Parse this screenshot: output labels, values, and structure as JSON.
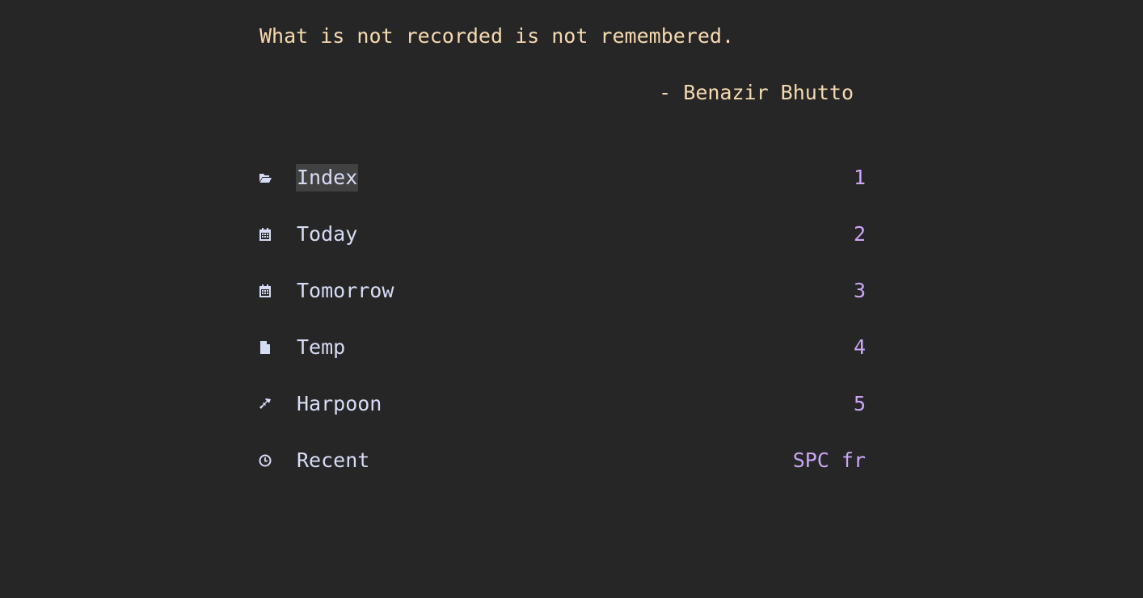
{
  "header": {
    "quote": "What is not recorded is not remembered.",
    "author": "- Benazir Bhutto"
  },
  "menu": {
    "items": [
      {
        "icon": "folder-open-icon",
        "label": "Index",
        "key": "1",
        "selected": true
      },
      {
        "icon": "calendar-icon",
        "label": "Today",
        "key": "2"
      },
      {
        "icon": "calendar-icon",
        "label": "Tomorrow",
        "key": "3"
      },
      {
        "icon": "file-icon",
        "label": "Temp",
        "key": "4"
      },
      {
        "icon": "harpoon-icon",
        "label": "Harpoon",
        "key": "5"
      },
      {
        "icon": "clock-icon",
        "label": "Recent",
        "key": "SPC fr"
      }
    ]
  },
  "colors": {
    "background": "#262626",
    "quote": "#f5d9b0",
    "label": "#d7dcf5",
    "key": "#cba6f7",
    "selection": "#414141"
  }
}
